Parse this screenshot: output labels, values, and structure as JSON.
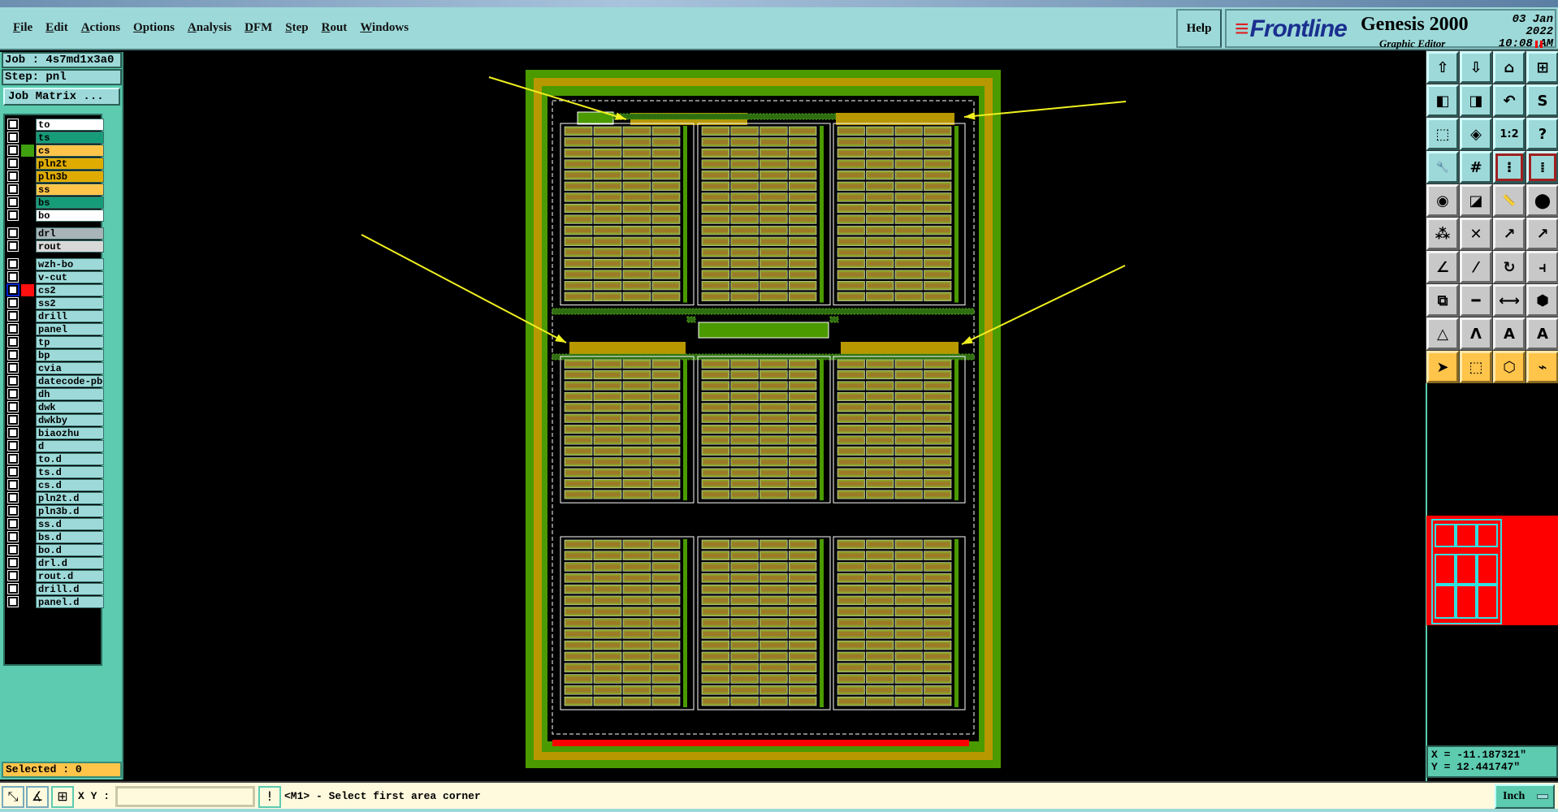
{
  "menu": [
    "File",
    "Edit",
    "Actions",
    "Options",
    "Analysis",
    "DFM",
    "Step",
    "Rout",
    "Windows"
  ],
  "help_label": "Help",
  "brand": {
    "logo": "Frontline",
    "product": "Genesis 2000",
    "subtitle": "Graphic Editor",
    "date": "03 Jan 2022",
    "time": "10:08 AM"
  },
  "job": "Job : 4s7md1x3a0",
  "step": "Step: pnl",
  "job_matrix_label": "Job Matrix ...",
  "layers": [
    {
      "name": "to",
      "color": "#ffffff",
      "group": 1
    },
    {
      "name": "ts",
      "color": "#169c78",
      "group": 1
    },
    {
      "name": "cs",
      "color": "#ffc44a",
      "group": 1,
      "swatch": "#3fa010"
    },
    {
      "name": "pln2t",
      "color": "#e0ab00",
      "group": 1
    },
    {
      "name": "pln3b",
      "color": "#e0ab00",
      "group": 1
    },
    {
      "name": "ss",
      "color": "#ffc44a",
      "group": 1
    },
    {
      "name": "bs",
      "color": "#169c78",
      "group": 1
    },
    {
      "name": "bo",
      "color": "#ffffff",
      "group": 1
    },
    {
      "name": "drl",
      "color": "#a8b4b8",
      "group": 2
    },
    {
      "name": "rout",
      "color": "#d8d8d8",
      "group": 2
    },
    {
      "name": "wzh-bo",
      "color": "#9dd9d9",
      "group": 3
    },
    {
      "name": "v-cut",
      "color": "#9dd9d9",
      "group": 3
    },
    {
      "name": "cs2",
      "color": "#9dd9d9",
      "group": 3,
      "swatch": "#ff1010",
      "active": true
    },
    {
      "name": "ss2",
      "color": "#9dd9d9",
      "group": 3
    },
    {
      "name": "drill",
      "color": "#9dd9d9",
      "group": 3
    },
    {
      "name": "panel",
      "color": "#9dd9d9",
      "group": 3
    },
    {
      "name": "tp",
      "color": "#9dd9d9",
      "group": 3
    },
    {
      "name": "bp",
      "color": "#9dd9d9",
      "group": 3
    },
    {
      "name": "cvia",
      "color": "#9dd9d9",
      "group": 3
    },
    {
      "name": "datecode-pbo",
      "color": "#9dd9d9",
      "group": 3
    },
    {
      "name": "dh",
      "color": "#9dd9d9",
      "group": 3
    },
    {
      "name": "dwk",
      "color": "#9dd9d9",
      "group": 3
    },
    {
      "name": "dwkby",
      "color": "#9dd9d9",
      "group": 3
    },
    {
      "name": "biaozhu",
      "color": "#9dd9d9",
      "group": 3
    },
    {
      "name": "d",
      "color": "#9dd9d9",
      "group": 3
    },
    {
      "name": "to.d",
      "color": "#9dd9d9",
      "group": 3
    },
    {
      "name": "ts.d",
      "color": "#9dd9d9",
      "group": 3
    },
    {
      "name": "cs.d",
      "color": "#9dd9d9",
      "group": 3
    },
    {
      "name": "pln2t.d",
      "color": "#9dd9d9",
      "group": 3
    },
    {
      "name": "pln3b.d",
      "color": "#9dd9d9",
      "group": 3
    },
    {
      "name": "ss.d",
      "color": "#9dd9d9",
      "group": 3
    },
    {
      "name": "bs.d",
      "color": "#9dd9d9",
      "group": 3
    },
    {
      "name": "bo.d",
      "color": "#9dd9d9",
      "group": 3
    },
    {
      "name": "drl.d",
      "color": "#9dd9d9",
      "group": 3
    },
    {
      "name": "rout.d",
      "color": "#9dd9d9",
      "group": 3
    },
    {
      "name": "drill.d",
      "color": "#9dd9d9",
      "group": 3
    },
    {
      "name": "panel.d",
      "color": "#9dd9d9",
      "group": 3
    }
  ],
  "selected": "Selected : 0",
  "status": {
    "xy_label": "X Y :",
    "xy_value": "",
    "prompt": "<M1> - Select first area corner",
    "units": "Inch"
  },
  "coords": {
    "x": "X = -11.187321\"",
    "y": "Y = 12.441747\""
  },
  "tools": [
    {
      "icon": "zoom-out-page-up-icon",
      "g": "⇧",
      "t": "teal"
    },
    {
      "icon": "page-down-icon",
      "g": "⇩",
      "t": "teal"
    },
    {
      "icon": "home-icon",
      "g": "⌂",
      "t": "teal"
    },
    {
      "icon": "xy-grid-icon",
      "g": "⊞",
      "t": "teal"
    },
    {
      "icon": "pan-left-icon",
      "g": "◧",
      "t": "teal"
    },
    {
      "icon": "pan-right-icon",
      "g": "◨",
      "t": "teal"
    },
    {
      "icon": "undo-view-icon",
      "g": "↶",
      "t": "teal"
    },
    {
      "icon": "snake-icon",
      "g": "S",
      "t": "teal"
    },
    {
      "icon": "zoom-fit-icon",
      "g": "⬚",
      "t": "teal"
    },
    {
      "icon": "zoom-center-icon",
      "g": "◈",
      "t": "teal"
    },
    {
      "icon": "scale-1-2-icon",
      "g": "1:2",
      "t": "teal"
    },
    {
      "icon": "help-icon",
      "g": "?",
      "t": "teal"
    },
    {
      "icon": "tools-palette-icon",
      "g": "🔧",
      "t": "teal"
    },
    {
      "icon": "grid-icon",
      "g": "#",
      "t": "teal"
    },
    {
      "icon": "netlist-signal-icon",
      "g": "⁝",
      "t": "teal",
      "red": true
    },
    {
      "icon": "netlist-stop-icon",
      "g": "⁞",
      "t": "teal",
      "red": true
    },
    {
      "icon": "pad-to-icon",
      "g": "◉",
      "t": "gray"
    },
    {
      "icon": "window-select-icon",
      "g": "◪",
      "t": "gray"
    },
    {
      "icon": "measure-ruler-icon",
      "g": "📏",
      "t": "gray"
    },
    {
      "icon": "pad-dashed-icon",
      "g": "⬤",
      "t": "gray"
    },
    {
      "icon": "connect-nodes-icon",
      "g": "⁂",
      "t": "gray"
    },
    {
      "icon": "delete-node-icon",
      "g": "✕",
      "t": "gray"
    },
    {
      "icon": "move-pad-icon",
      "g": "↗",
      "t": "gray"
    },
    {
      "icon": "copy-pad-icon",
      "g": "↗",
      "t": "gray"
    },
    {
      "icon": "line-angle-icon",
      "g": "∠",
      "t": "gray"
    },
    {
      "icon": "line-slash-icon",
      "g": "⁄",
      "t": "gray"
    },
    {
      "icon": "rotate-icon",
      "g": "↻",
      "t": "gray"
    },
    {
      "icon": "mirror-icon",
      "g": "⫞",
      "t": "gray"
    },
    {
      "icon": "resize-pad-icon",
      "g": "⧉",
      "t": "gray"
    },
    {
      "icon": "line-segment-icon",
      "g": "━",
      "t": "gray"
    },
    {
      "icon": "dimension-icon",
      "g": "⟷",
      "t": "gray"
    },
    {
      "icon": "contour-icon",
      "g": "⬢",
      "t": "gray"
    },
    {
      "icon": "triangle-icon",
      "g": "△",
      "t": "gray"
    },
    {
      "icon": "arc-a-icon",
      "g": "Λ",
      "t": "gray"
    },
    {
      "icon": "arc-b-icon",
      "g": "A",
      "t": "gray"
    },
    {
      "icon": "arc-c-icon",
      "g": "A",
      "t": "gray"
    },
    {
      "icon": "select-pointer-icon",
      "g": "➤",
      "t": "yel"
    },
    {
      "icon": "select-box-icon",
      "g": "⬚",
      "t": "yel"
    },
    {
      "icon": "select-polygon-icon",
      "g": "⬡",
      "t": "yel"
    },
    {
      "icon": "select-net-icon",
      "g": "⌁",
      "t": "yel"
    }
  ],
  "colors": {
    "board_green": "#4a9a00",
    "board_gold": "#b89800",
    "highlight": "#ff0000",
    "arrows": "#f0f020"
  }
}
